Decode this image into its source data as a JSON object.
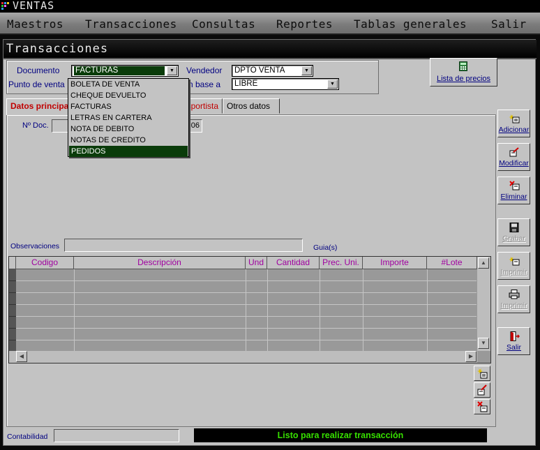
{
  "app": {
    "title": "VENTAS"
  },
  "menu": [
    "Maestros",
    "Transacciones",
    "Consultas",
    "Reportes",
    "Tablas generales",
    "Salir"
  ],
  "window": {
    "title": "Transacciones"
  },
  "header": {
    "documento_label": "Documento",
    "documento_value": "FACTURAS",
    "punto_venta_label": "Punto de venta",
    "vendedor_label": "Vendedor",
    "vendedor_value": "DPTO VENTA",
    "en_base_label": "En base a",
    "en_base_value": "LIBRE",
    "lista_precios_label": "Lista de precios"
  },
  "dropdown": {
    "items": [
      "BOLETA DE VENTA",
      "CHEQUE DEVUELTO",
      "FACTURAS",
      "LETRAS EN CARTERA",
      "NOTA DE DEBITO",
      "NOTAS DE CREDITO",
      "PEDIDOS"
    ],
    "highlighted": "PEDIDOS"
  },
  "tabs": {
    "principal": "Datos principales",
    "transportista": "Transportista",
    "otros": "Otros datos"
  },
  "form": {
    "nro_doc_label": "Nº Doc.",
    "nro_doc_value": "06",
    "observaciones_label": "Observaciones",
    "guias_label": "Guia(s)"
  },
  "grid": {
    "columns": [
      "Codigo",
      "Descripción",
      "Und",
      "Cantidad",
      "Prec. Uni.",
      "Importe",
      "#Lote"
    ],
    "rows": []
  },
  "side_buttons": [
    {
      "label": "Adicionar",
      "icon": "add-icon",
      "enabled": true
    },
    {
      "label": "Modificar",
      "icon": "edit-icon",
      "enabled": true
    },
    {
      "label": "Eliminar",
      "icon": "delete-icon",
      "enabled": true
    },
    {
      "label": "Grabar",
      "icon": "save-icon",
      "enabled": false
    },
    {
      "label": "Imprimir",
      "icon": "print-icon",
      "enabled": false
    },
    {
      "label": "Imprimir",
      "icon": "printer-icon",
      "enabled": false
    },
    {
      "label": "Salir",
      "icon": "exit-door-icon",
      "enabled": true
    }
  ],
  "status": {
    "label": "Contabilidad",
    "message": "Listo para realizar transacción"
  },
  "colors": {
    "selection": "#0a3c0a",
    "status_text": "#37e000",
    "tab_active": "#c00000",
    "grid_header": "#a000a0",
    "link": "#000080"
  }
}
